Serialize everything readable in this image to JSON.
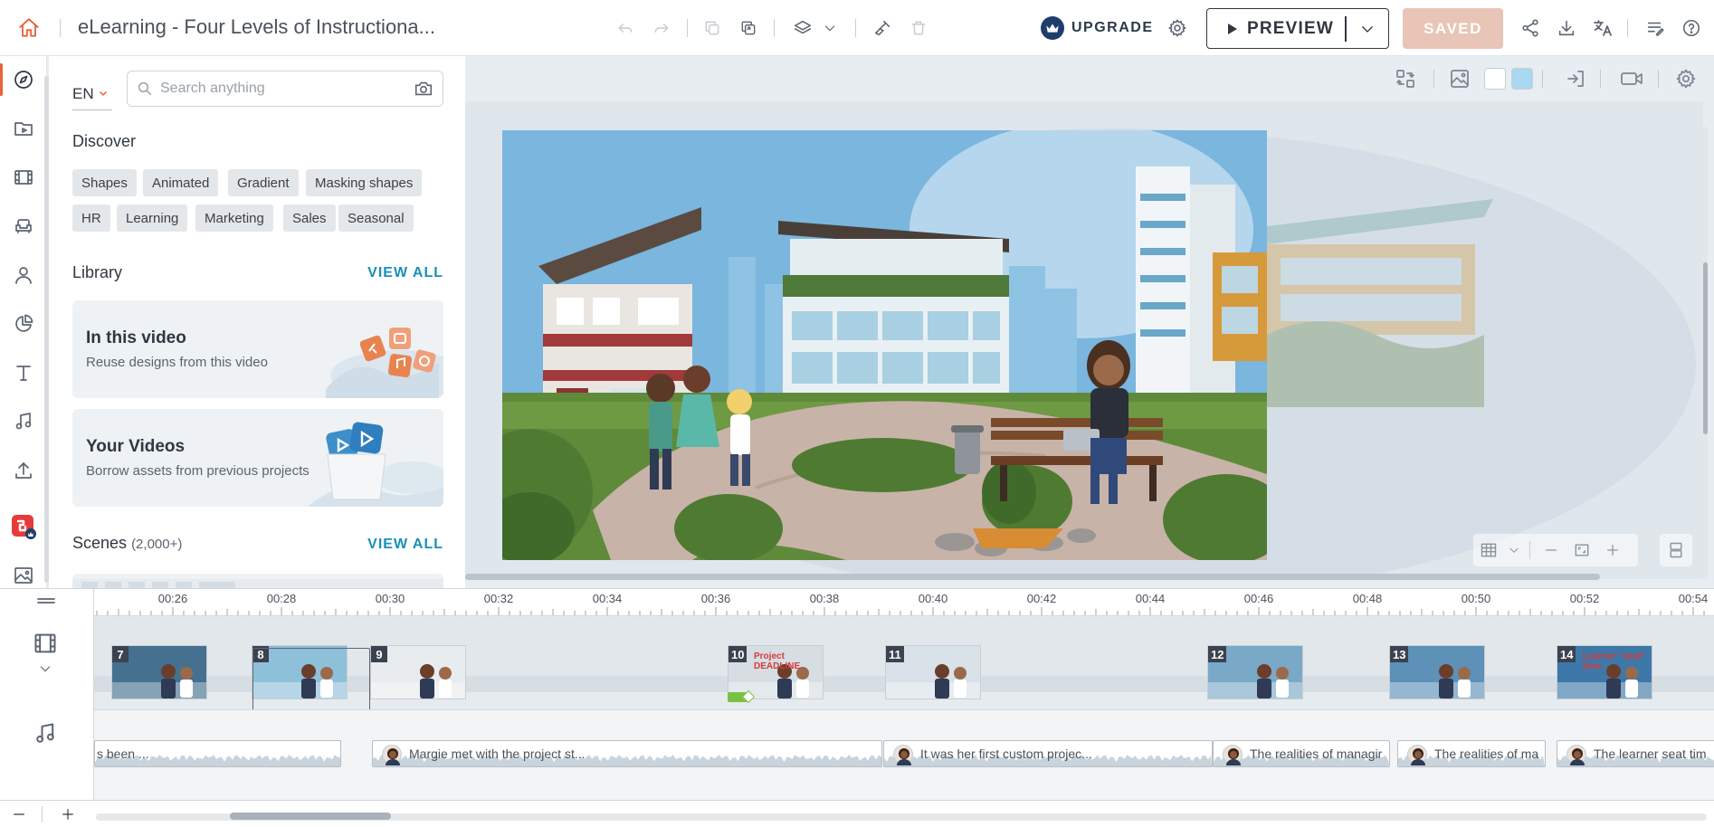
{
  "header": {
    "title": "eLearning - Four Levels of Instructiona...",
    "upgrade_label": "UPGRADE",
    "preview_label": "PREVIEW",
    "saved_label": "SAVED"
  },
  "panel": {
    "language": "EN",
    "search_placeholder": "Search anything",
    "discover_title": "Discover",
    "tags": [
      "Shapes",
      "Animated",
      "Gradient",
      "Masking shapes",
      "HR",
      "Learning",
      "Marketing",
      "Sales",
      "Seasonal"
    ],
    "library_title": "Library",
    "library_view_all": "VIEW ALL",
    "cards": [
      {
        "title": "In this video",
        "subtitle": "Reuse designs from this video"
      },
      {
        "title": "Your Videos",
        "subtitle": "Borrow assets from previous projects"
      }
    ],
    "scenes_title": "Scenes",
    "scenes_count": "(2,000+)",
    "scenes_view_all": "VIEW ALL"
  },
  "timeline": {
    "ticks": [
      "00:26",
      "00:28",
      "00:30",
      "00:32",
      "00:34",
      "00:36",
      "00:38",
      "00:40",
      "00:42",
      "00:44",
      "00:46",
      "00:48",
      "00:50",
      "00:52",
      "00:54"
    ],
    "scenes": [
      {
        "number": "7"
      },
      {
        "number": "8"
      },
      {
        "number": "9"
      },
      {
        "number": "10",
        "text": "Project DEADLINE"
      },
      {
        "number": "11"
      },
      {
        "number": "12"
      },
      {
        "number": "13"
      },
      {
        "number": "14",
        "text": "Learner \"seat\" time"
      }
    ],
    "clips": [
      {
        "text": "s been ..."
      },
      {
        "text": "Margie met with the project st..."
      },
      {
        "text": "It was her first custom projec..."
      },
      {
        "text": "The realities of managir"
      },
      {
        "text": "The realities of ma"
      },
      {
        "text": "The learner seat tim"
      }
    ]
  },
  "colors": {
    "accent": "#e8623a",
    "link": "#1a8fb8",
    "saved_bg": "#e8c5b6",
    "upgrade_crown": "#1f3d6a"
  }
}
